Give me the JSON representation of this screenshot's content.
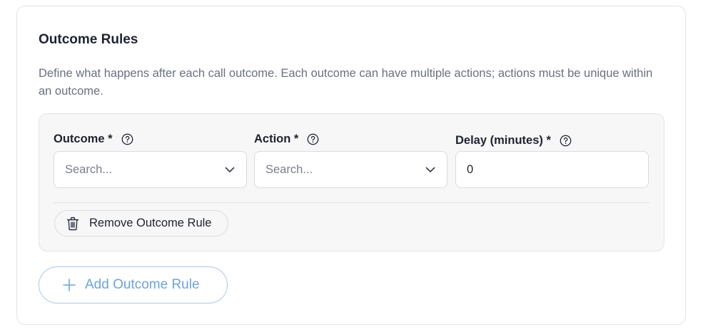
{
  "section": {
    "title": "Outcome Rules",
    "description": "Define what happens after each call outcome. Each outcome can have multiple actions; actions must be unique within an outcome."
  },
  "rule": {
    "outcome": {
      "label": "Outcome *",
      "placeholder": "Search..."
    },
    "action": {
      "label": "Action *",
      "placeholder": "Search..."
    },
    "delay": {
      "label": "Delay (minutes) *",
      "value": "0"
    },
    "remove_label": "Remove Outcome Rule"
  },
  "add_label": "Add Outcome Rule",
  "icons": {
    "help": "help-circle-icon",
    "dropdown": "chevron-down-icon",
    "remove": "trash-icon",
    "add": "plus-icon"
  },
  "colors": {
    "accent": "#6ea3dc",
    "panel_bg": "#f7f7f8",
    "muted_text": "#6b7080"
  }
}
